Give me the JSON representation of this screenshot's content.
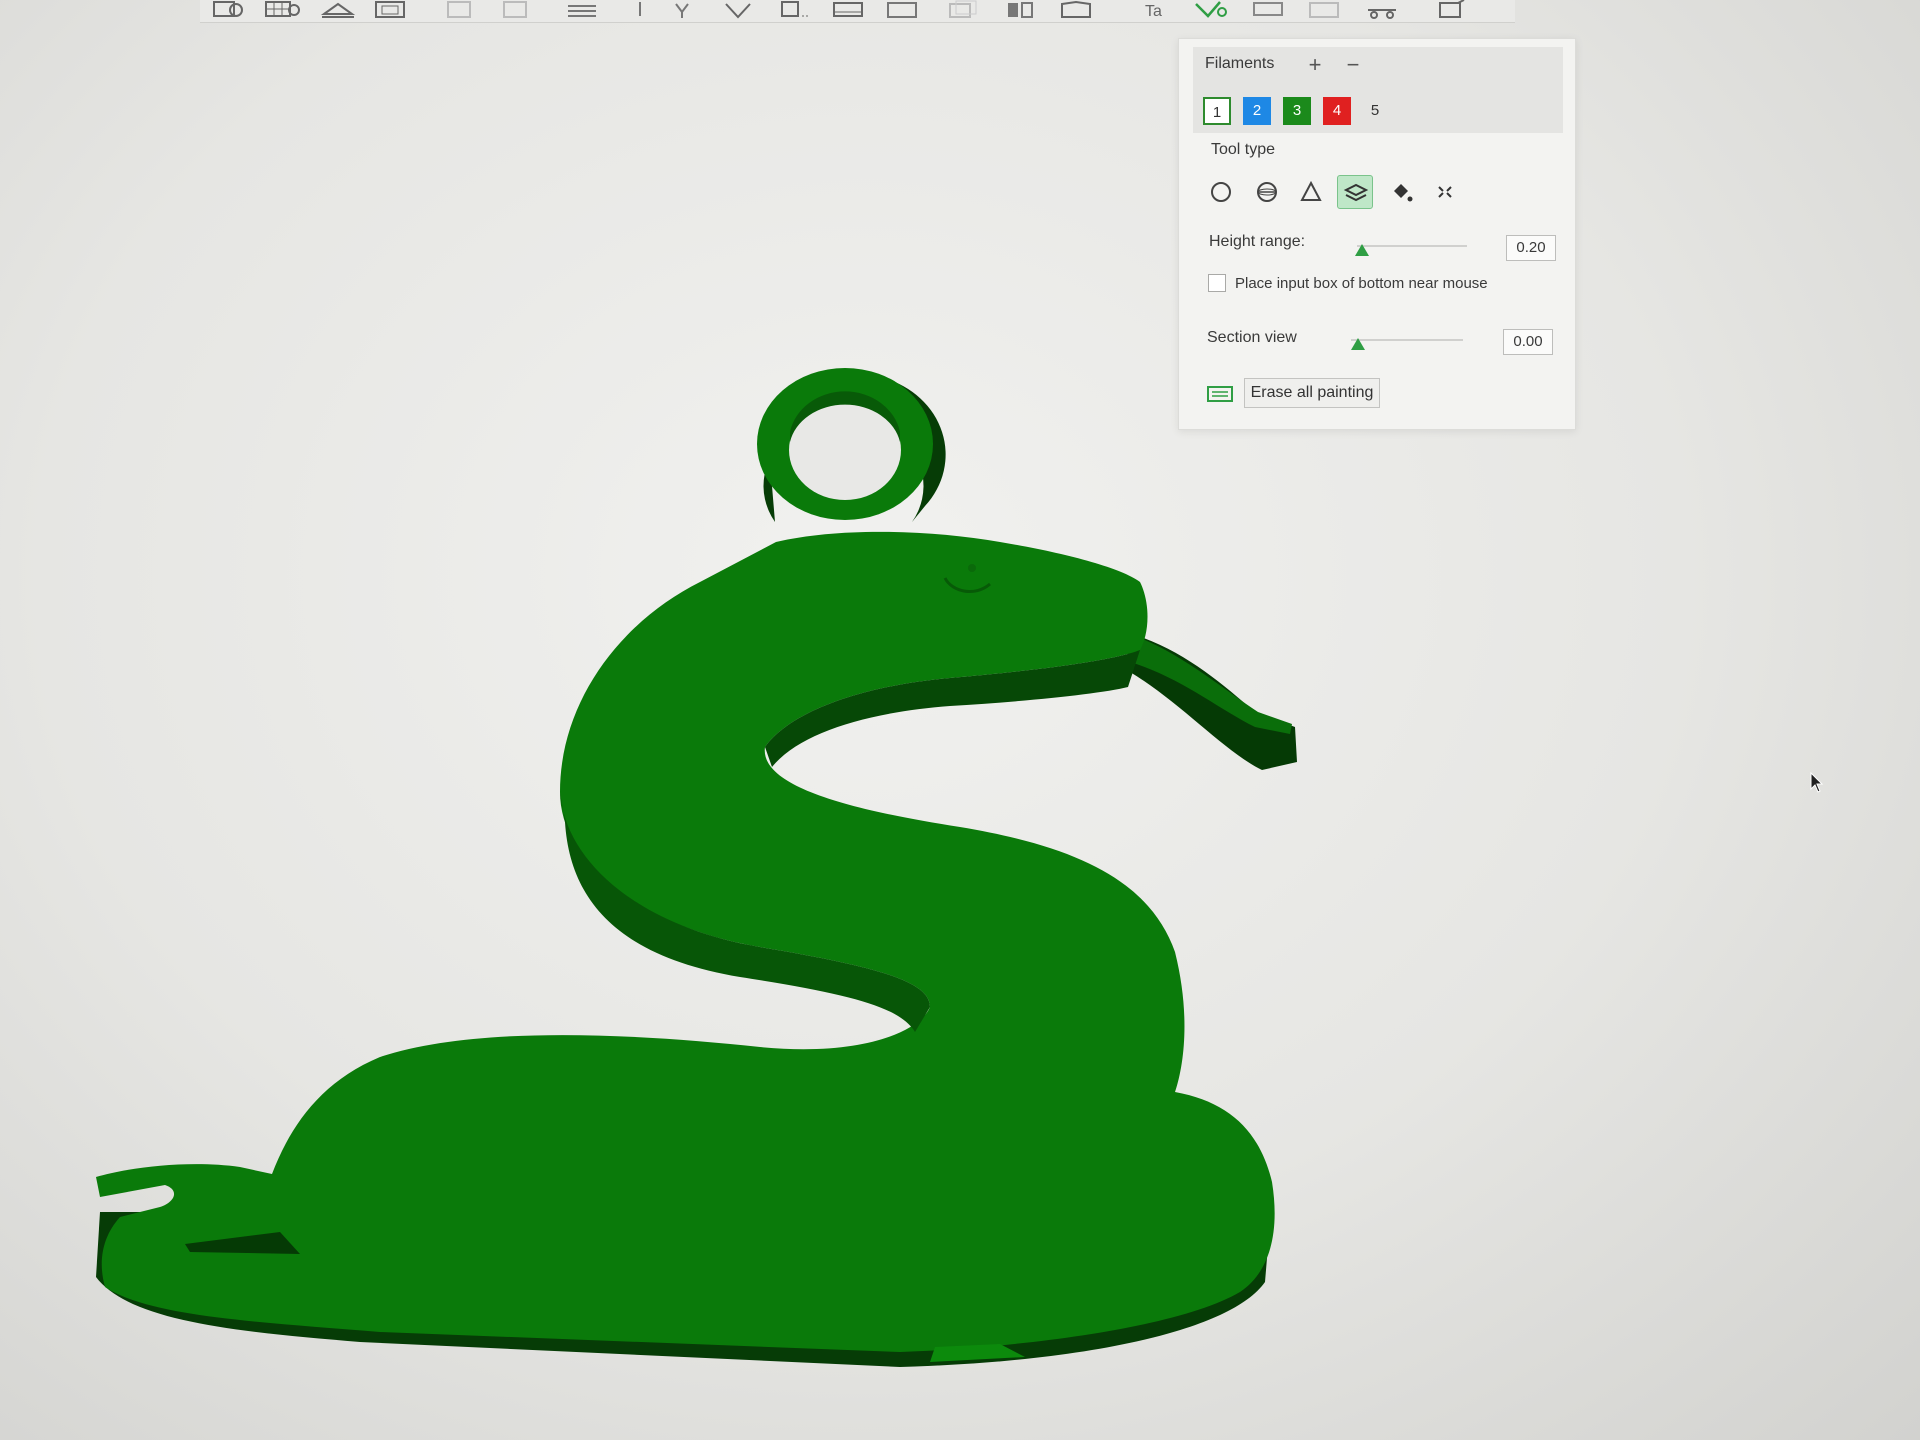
{
  "toolbar": {
    "buttons": [
      "add-plate-icon",
      "arrange-icon",
      "orient-icon",
      "layout-icon",
      "move-icon",
      "rotate-icon",
      "scale-icon",
      "cut-icon",
      "support-paint-icon",
      "seam-paint-icon",
      "measure-icon",
      "assembly-icon",
      "color-paint-icon",
      "text-icon",
      "mesh-boolean-icon"
    ]
  },
  "panel": {
    "filaments_label": "Filaments",
    "add_icon": "plus-icon",
    "remove_icon": "minus-icon",
    "filaments": [
      {
        "label": "1",
        "color": "#ffffff",
        "selected": true
      },
      {
        "label": "2",
        "color": "#1e88e5",
        "selected": false
      },
      {
        "label": "3",
        "color": "#1b8a1b",
        "selected": false
      },
      {
        "label": "4",
        "color": "#e02020",
        "selected": false
      },
      {
        "label": "5",
        "color": "",
        "selected": false
      }
    ],
    "tool_type_label": "Tool type",
    "tools": [
      "circle-icon",
      "sphere-icon",
      "triangle-icon",
      "height-range-icon",
      "fill-icon",
      "gap-fill-icon"
    ],
    "active_tool": "height-range-icon",
    "height_range_label": "Height range:",
    "height_range_value": "0.20",
    "place_input_label": "Place input box of bottom near mouse",
    "place_input_checked": false,
    "section_view_label": "Section view",
    "section_view_value": "0.00",
    "erase_label": "Erase all painting"
  },
  "model": {
    "color": "#0a7a0a",
    "shadow_color": "#063c06"
  }
}
